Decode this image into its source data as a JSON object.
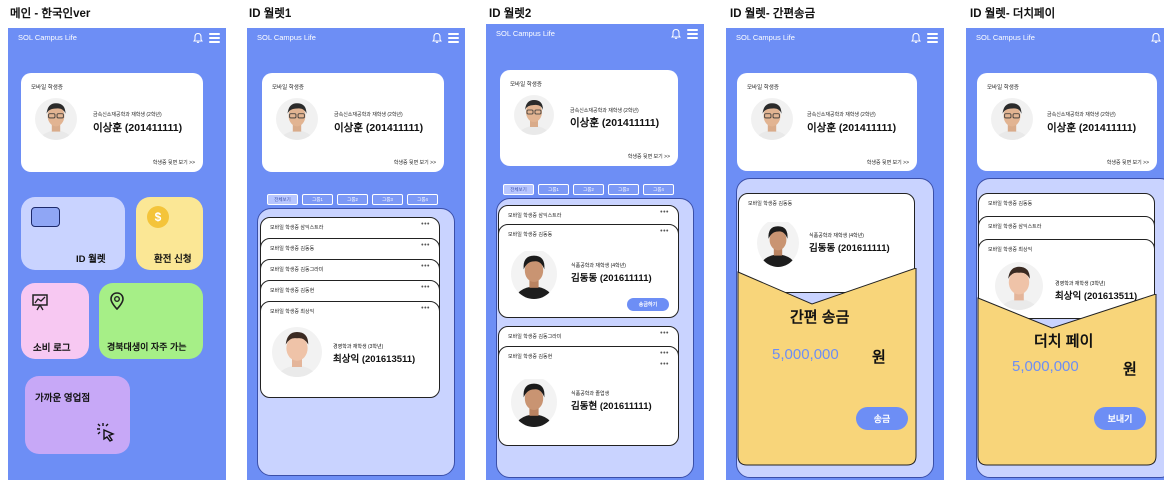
{
  "frames": [
    {
      "title": "메인 - 한국인ver"
    },
    {
      "title": "ID 월렛1"
    },
    {
      "title": "ID 월렛2"
    },
    {
      "title": "ID 월렛- 간편송금"
    },
    {
      "title": "ID 월렛- 더치페이"
    }
  ],
  "app": {
    "brand": "SOL Campus Life"
  },
  "student_card": {
    "label": "모바일 학생증",
    "dept": "금속신소재공학과 재학생 (2학년)",
    "name": "이상훈 (201411111)",
    "view_back": "학생증 뒷면 보기 >>"
  },
  "main": {
    "tiles": {
      "id_wallet": "ID 월렛",
      "exchange": "환전 신청",
      "spending_log": "소비 로그",
      "frequent_places": "경북대생이 자주 가는",
      "nearby_branch": "가까운 영업점"
    },
    "colors": {
      "id_wallet": "#c9d3ff",
      "exchange": "#fbe795",
      "spending_log": "#f7c8f2",
      "frequent_places": "#a6ef87",
      "nearby_branch": "#c7a8f7"
    }
  },
  "wallet1": {
    "tabs": [
      "전체보기",
      "그룹1",
      "그룹2",
      "그룹3",
      "그룹4"
    ],
    "cards": [
      "모바일 학생증 삼익스트라",
      "모바일 학생증 김동동",
      "모바일 학생증 김동그라미",
      "모바일 학생증 김동현",
      "모바일 학생증 최상익"
    ],
    "featured": {
      "dept": "경영학과 재학생 (3학년)",
      "name": "최상익 (201613511)"
    },
    "more": "•••"
  },
  "wallet2": {
    "tabs": [
      "전체보기",
      "그룹1",
      "그룹2",
      "그룹3",
      "그룹4"
    ],
    "top_cards": [
      "모바일 학생증 삼익스트라",
      "모바일 학생증 김동동"
    ],
    "card_a": {
      "dept": "식품공학과 재학생 (4학년)",
      "name": "김동동 (201611111)",
      "button": "송금하기"
    },
    "bottom_cards": [
      "모바일 학생증 김동그라미",
      "모바일 학생증 김동현"
    ],
    "card_b": {
      "dept": "식품공학과 졸업생",
      "name": "김동현 (201611111)"
    },
    "more": "•••"
  },
  "remit": {
    "card_label": "모바일 학생증 김동동",
    "dept": "식품공학과 재학생 (4학년)",
    "name": "김동동 (201611111)",
    "title": "간편 송금",
    "amount": "5,000,000",
    "unit": "원",
    "button": "송금"
  },
  "dutch": {
    "cards": [
      "모바일 학생증 김동동",
      "모바일 학생증 삼익스트라",
      "모바일 학생증 최상익"
    ],
    "dept": "경영학과 재학생 (3학년)",
    "name": "최상익 (201613511)",
    "title": "더치 페이",
    "amount": "5,000,000",
    "unit": "원",
    "button": "보내기"
  }
}
